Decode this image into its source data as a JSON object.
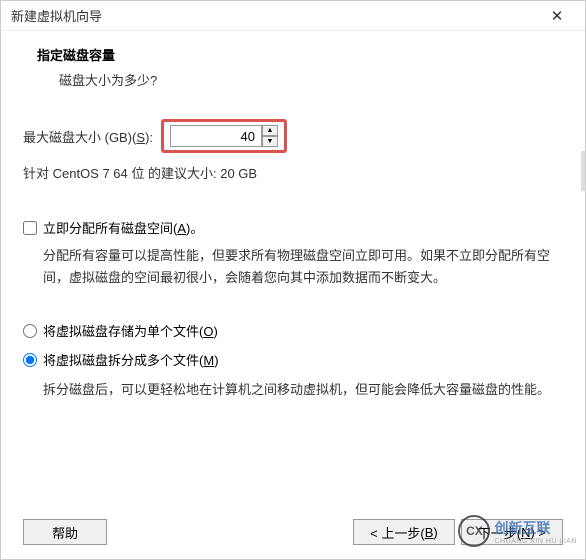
{
  "titlebar": {
    "title": "新建虚拟机向导",
    "close": "✕"
  },
  "header": {
    "title": "指定磁盘容量",
    "sub": "磁盘大小为多少?"
  },
  "diskSize": {
    "label_pre": "最大磁盘大小 (GB)(",
    "label_key": "S",
    "label_post": "):",
    "value": "40",
    "recommendation": "针对 CentOS 7 64 位 的建议大小: 20 GB"
  },
  "allocateNow": {
    "label_pre": "立即分配所有磁盘空间(",
    "label_key": "A",
    "label_post": ")。",
    "desc": "分配所有容量可以提高性能，但要求所有物理磁盘空间立即可用。如果不立即分配所有空间，虚拟磁盘的空间最初很小，会随着您向其中添加数据而不断变大。",
    "checked": false
  },
  "storage": {
    "single_pre": "将虚拟磁盘存储为单个文件(",
    "single_key": "O",
    "single_post": ")",
    "multi_pre": "将虚拟磁盘拆分成多个文件(",
    "multi_key": "M",
    "multi_post": ")",
    "multi_desc": "拆分磁盘后，可以更轻松地在计算机之间移动虚拟机，但可能会降低大容量磁盘的性能。"
  },
  "buttons": {
    "help": "帮助",
    "back_pre": "< 上一步(",
    "back_key": "B",
    "back_post": ")",
    "next_pre": "下一步(",
    "next_key": "N",
    "next_post": ") >"
  },
  "watermark": {
    "logo": "CX",
    "text": "创新互联",
    "sub": "CHUANG XIN HU LIAN"
  }
}
